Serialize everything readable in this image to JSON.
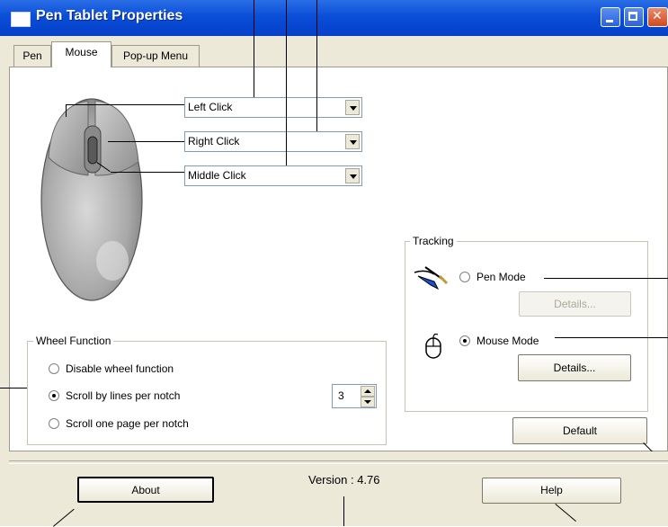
{
  "window": {
    "title": "Pen Tablet Properties"
  },
  "tabs": [
    {
      "label": "Pen",
      "active": false
    },
    {
      "label": "Mouse",
      "active": true
    },
    {
      "label": "Pop-up Menu",
      "active": false
    }
  ],
  "buttons_map": {
    "left": {
      "value": "Left Click"
    },
    "right": {
      "value": "Right Click"
    },
    "middle": {
      "value": "Middle Click"
    }
  },
  "wheel": {
    "label": "Wheel Function",
    "options": [
      {
        "label": "Disable wheel function",
        "selected": false
      },
      {
        "label": "Scroll by lines per notch",
        "selected": true
      },
      {
        "label": "Scroll one page per notch",
        "selected": false
      }
    ],
    "lines_value": "3"
  },
  "tracking": {
    "label": "Tracking",
    "pen_mode": {
      "label": "Pen Mode",
      "selected": false
    },
    "pen_details": "Details...",
    "mouse_mode": {
      "label": "Mouse Mode",
      "selected": true
    },
    "mouse_details": "Details..."
  },
  "default_button": "Default",
  "footer": {
    "about": "About",
    "version": "Version : 4.76",
    "help": "Help"
  },
  "colors": {
    "titlebar": "#0a4ed8",
    "dialog": "#ece9d8",
    "panel": "#ffffff"
  }
}
